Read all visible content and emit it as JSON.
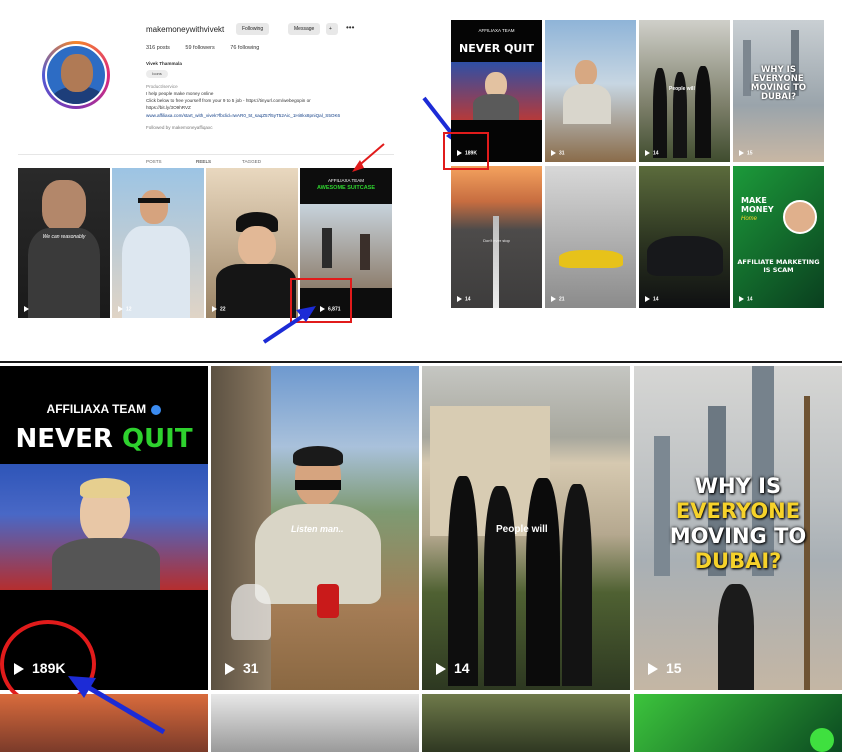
{
  "profile": {
    "username": "makemoneywithvivekt",
    "following_btn": "Following",
    "message_btn": "Message",
    "posts": "316 posts",
    "followers": "59 followers",
    "following": "76 following",
    "name": "Vivek Thammala",
    "tag": "Icons",
    "category": "Product/service",
    "bio1": "I help people make money online",
    "bio2": "Click below to free yourself from your 9 to 5 job - https://tinyurl.com/webegopin or",
    "bio3": "https://bit.ly/3O9hRVZ",
    "link": "www.affiliaxa.com/start_with_vivek?fbclid=IwAR0_5t_saqZ57l5yT52Aic_1HiIIkx8pniQal_S5OK6",
    "followed_by": "Followed by makemoneyaffiqaxc",
    "tab_posts": "POSTS",
    "tab_reels": "REELS",
    "tab_tagged": "TAGGED",
    "reels": [
      {
        "caption": "We can reasonably",
        "count": ""
      },
      {
        "caption": "",
        "count": "12"
      },
      {
        "caption": "",
        "count": "22"
      },
      {
        "caption": "AWESOME SUITCASE",
        "brand": "AFFILIAXA TEAM",
        "count": "6,871"
      }
    ]
  },
  "grid_small": [
    {
      "title": "NEVER QUIT",
      "brand": "AFFILIAXA TEAM",
      "count": "189K"
    },
    {
      "count": "31"
    },
    {
      "caption": "People will",
      "count": "14"
    },
    {
      "title": "WHY IS EVERYONE MOVING TO DUBAI?",
      "count": "15"
    },
    {
      "caption": "Don't ever stop",
      "count": "14"
    },
    {
      "count": "21"
    },
    {
      "count": "14"
    },
    {
      "title1": "MAKE MONEY",
      "title2": "Home",
      "title3": "AFFILIATE MARKETING IS SCAM",
      "count": "14"
    }
  ],
  "grid_big": [
    {
      "brand": "AFFILIAXA TEAM",
      "title1": "NEVER",
      "title2": "QUIT",
      "count": "189K"
    },
    {
      "caption": "Listen man..",
      "count": "31"
    },
    {
      "caption": "People will",
      "count": "14"
    },
    {
      "title_line1": "WHY IS",
      "title_line2": "EVERYONE",
      "title_line3": "MOVING TO",
      "title_line4": "DUBAI?",
      "count": "15"
    }
  ],
  "colors": {
    "annotation_red": "#e11b1b",
    "annotation_blue": "#1c2bd6",
    "accent_green": "#2ed12e",
    "accent_yellow": "#f6d22a"
  }
}
